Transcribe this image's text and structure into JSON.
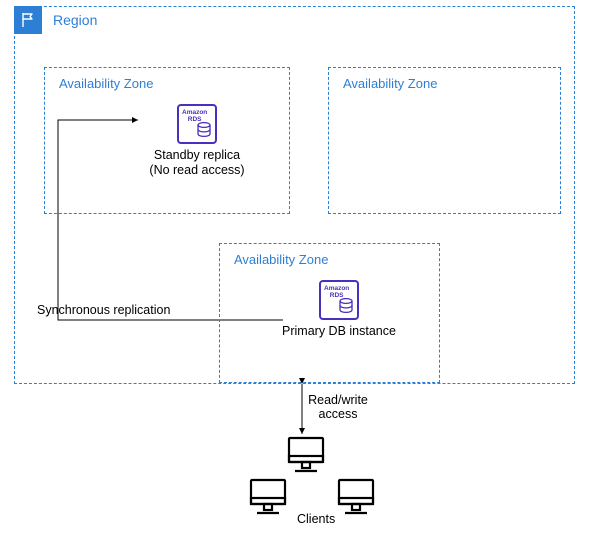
{
  "region": {
    "label": "Region"
  },
  "az1": {
    "label": "Availability Zone"
  },
  "az2": {
    "label": "Availability Zone"
  },
  "az3": {
    "label": "Availability Zone"
  },
  "standby": {
    "icon_top": "Amazon",
    "icon_bottom": "RDS",
    "label_line1": "Standby replica",
    "label_line2": "(No read access)"
  },
  "primary": {
    "icon_top": "Amazon",
    "icon_bottom": "RDS",
    "label": "Primary DB instance"
  },
  "replication_label": "Synchronous replication",
  "rw": {
    "line1": "Read/write",
    "line2": "access"
  },
  "clients": {
    "label": "Clients"
  }
}
